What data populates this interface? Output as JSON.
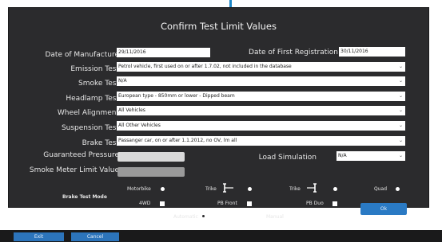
{
  "dialog": {
    "title": "Confirm Test Limit Values"
  },
  "form": {
    "date_of_manufacture_label": "Date of Manufacture",
    "date_of_manufacture_value": "29/11/2016",
    "date_of_first_registration_label": "Date of First Registration",
    "date_of_first_registration_value": "30/11/2016",
    "emission_test_label": "Emission Test",
    "emission_test_value": "Petrol vehicle, first used on or after 1.7.02, not included in the database",
    "smoke_test_label": "Smoke Test",
    "smoke_test_value": "N/A",
    "headlamp_test_label": "Headlamp Test",
    "headlamp_test_value": "European type - 850mm or lower - Dipped beam",
    "wheel_alignment_label": "Wheel Alignment",
    "wheel_alignment_value": "All Vehicles",
    "suspension_test_label": "Suspension Test",
    "suspension_test_value": "All Other Vehicles",
    "brake_test_label": "Brake Test",
    "brake_test_value": "Passanger car, on or after 1.1.2012, no OV, lm all",
    "guaranteed_pressure_label": "Guaranteed Pressure",
    "guaranteed_pressure_value": "",
    "load_simulation_label": "Load Simulation",
    "load_simulation_value": "N/A",
    "smoke_meter_limit_label": "Smoke Meter Limit Value",
    "smoke_meter_limit_value": ""
  },
  "brake_test_mode": {
    "label": "Brake Test Mode",
    "vehicle_options": [
      "Motorbike",
      "Trike",
      "Trike",
      "Quad"
    ],
    "drive_options": [
      "4WD",
      "PB Front",
      "PB Duo"
    ],
    "mode_options": [
      "Automatic",
      "Manual"
    ],
    "selected_mode": "Automatic"
  },
  "buttons": {
    "ok": "Ok",
    "exit": "Exit",
    "cancel": "Cancel"
  },
  "icons": {
    "dropdown": "chevron-down-icon",
    "trike_front": "trike-front-icon",
    "trike_rear": "trike-rear-icon"
  },
  "colors": {
    "dialog_background": "#2b2b2d",
    "accent_blue": "#2a7ac4",
    "guaranteed_pressure_box": "#dadada",
    "smoke_meter_box": "#9a9a9a"
  }
}
